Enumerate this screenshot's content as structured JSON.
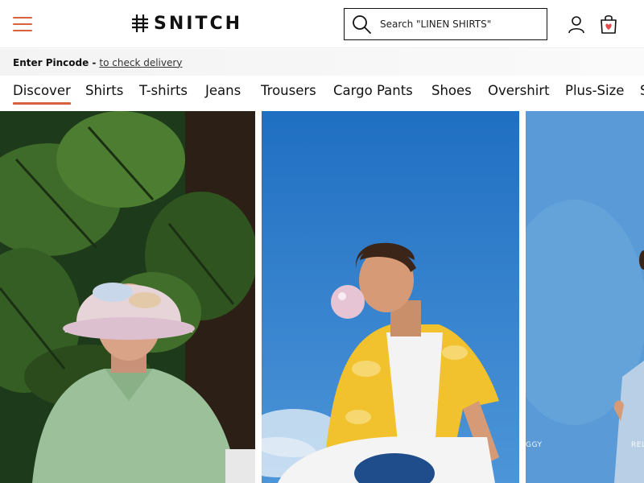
{
  "brand": {
    "name": "SNITCH",
    "accent": "#d9603f"
  },
  "header": {
    "menu_icon": "hamburger-menu-icon",
    "search_placeholder": "Search \"LINEN SHIRTS\"",
    "search_icon": "search-icon",
    "user_icon": "user-icon",
    "cart_icon": "shopping-bag-heart-icon"
  },
  "pincode": {
    "label": "Enter Pincode -",
    "link": "to check delivery"
  },
  "categories": [
    {
      "label": "Discover",
      "active": true
    },
    {
      "label": "Shirts"
    },
    {
      "label": "T-shirts"
    },
    {
      "label": "Jeans"
    },
    {
      "label": "Trousers"
    },
    {
      "label": "Cargo Pants"
    },
    {
      "label": "Shoes"
    },
    {
      "label": "Overshirt"
    },
    {
      "label": "Plus-Size"
    },
    {
      "label": "S"
    }
  ],
  "banners": {
    "overlay_left": "GGY",
    "overlay_right": "REL"
  }
}
